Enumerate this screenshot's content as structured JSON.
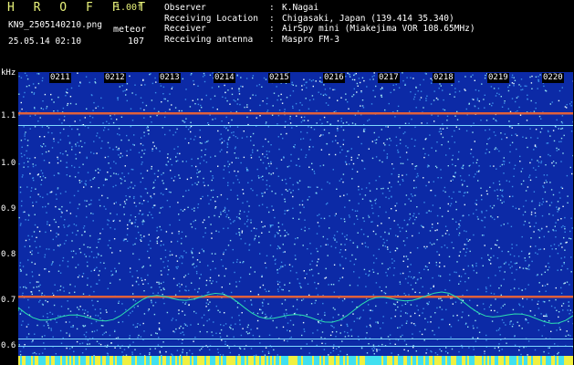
{
  "app": {
    "title": "H R O F F T",
    "version": "1.00f",
    "filename": "KN9_2505140210.png",
    "mode": "meteor",
    "datetime": "25.05.14 02:10",
    "count": "107"
  },
  "meta": [
    {
      "key": "Observer",
      "sep": ":",
      "value": "K.Nagai"
    },
    {
      "key": "Receiving Location",
      "sep": ":",
      "value": "Chigasaki, Japan (139.414 35.340)"
    },
    {
      "key": "Receiver",
      "sep": ":",
      "value": "AirSpy mini (Miakejima VOR 108.65MHz)"
    },
    {
      "key": "Receiving antenna",
      "sep": ":",
      "value": "Maspro FM-3"
    }
  ],
  "axis": {
    "unit": "kHz",
    "yticks": [
      "1.1",
      "1.0",
      "0.9",
      "0.8",
      "0.7",
      "0.6"
    ],
    "xticks": [
      "0211",
      "0212",
      "0213",
      "0214",
      "0215",
      "0216",
      "0217",
      "0218",
      "0219",
      "0220"
    ]
  },
  "colors": {
    "background": "#0c2aa6",
    "carrier": "#e0603a",
    "trace": "#2ce0b0",
    "title": "#e8f27a"
  }
}
